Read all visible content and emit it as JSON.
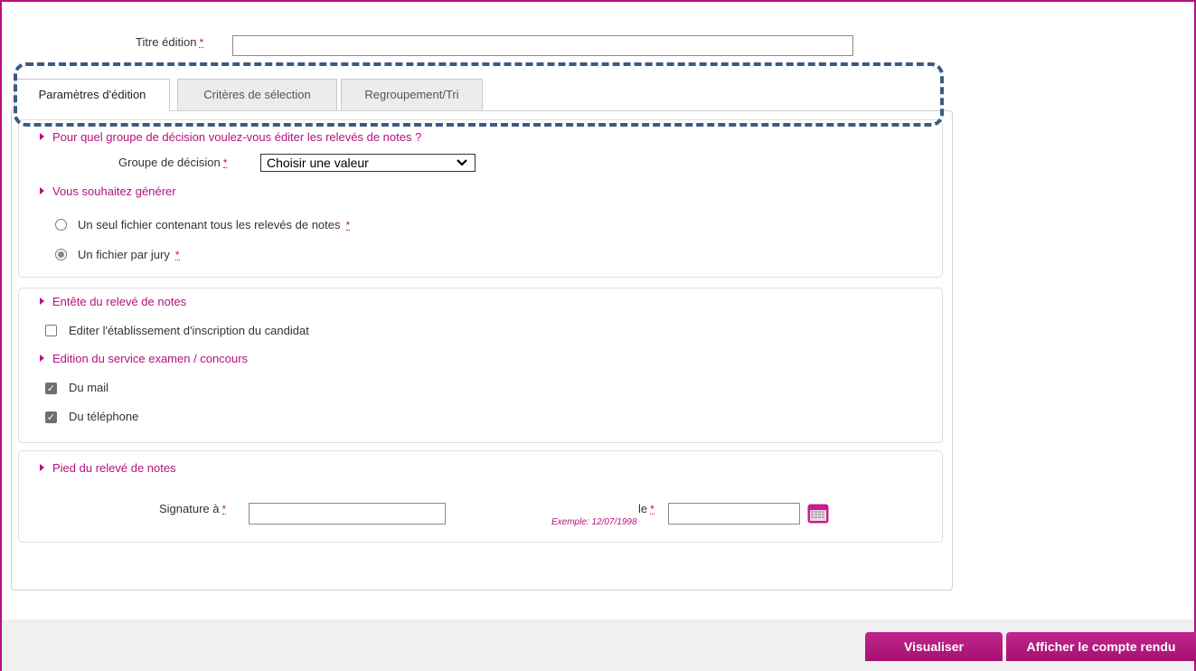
{
  "form": {
    "title_label": "Titre édition",
    "title_value": "",
    "required_mark": "*"
  },
  "tabs": [
    {
      "label": "Paramètres d'édition",
      "active": true
    },
    {
      "label": "Critères de sélection",
      "active": false
    },
    {
      "label": "Regroupement/Tri",
      "active": false
    }
  ],
  "decision": {
    "section_title": "Pour quel groupe de décision voulez-vous éditer les relevés de notes ?",
    "group_label": "Groupe de décision",
    "group_value": "Choisir une valeur",
    "generate_title": "Vous souhaitez générer",
    "options": [
      {
        "label": "Un seul fichier contenant tous les relevés de notes",
        "selected": false
      },
      {
        "label": "Un fichier par jury",
        "selected": true
      }
    ]
  },
  "header": {
    "section_title": "Entête du relevé de notes",
    "edit_institution_label": "Editer l'établissement d'inscription du candidat",
    "edit_institution_checked": false,
    "service_title": "Edition du service examen / concours",
    "mail_label": "Du mail",
    "mail_checked": true,
    "phone_label": "Du téléphone",
    "phone_checked": true
  },
  "footer_section": {
    "section_title": "Pied du relevé de notes",
    "signature_label": "Signature à",
    "signature_value": "",
    "date_label": "le",
    "date_example": "Exemple: 12/07/1998",
    "date_value": ""
  },
  "actions": {
    "preview_label": "Visualiser",
    "report_label": "Afficher le compte rendu"
  },
  "colors": {
    "accent": "#b5117f",
    "highlight_dash": "#3c5b80"
  }
}
